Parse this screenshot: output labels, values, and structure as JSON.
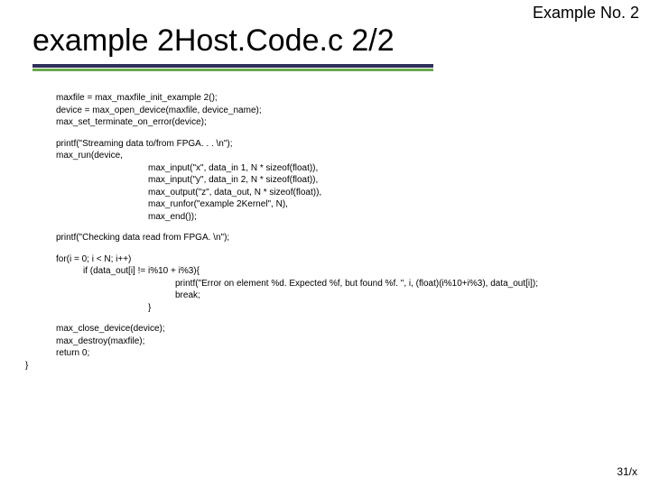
{
  "example_label": "Example No. 2",
  "title": "example 2Host.Code.c 2/2",
  "code": {
    "blk1_l1": "maxfile = max_maxfile_init_example 2();",
    "blk1_l2": "device = max_open_device(maxfile, device_name);",
    "blk1_l3": "max_set_terminate_on_error(device);",
    "blk2_l1": "printf(\"Streaming data to/from FPGA. . . \\n\");",
    "blk2_l2": "max_run(device,",
    "blk2_l3": "max_input(\"x\", data_in 1, N * sizeof(float)),",
    "blk2_l4": "max_input(\"y\", data_in 2, N * sizeof(float)),",
    "blk2_l5": "max_output(\"z\", data_out, N * sizeof(float)),",
    "blk2_l6": "max_runfor(\"example 2Kernel\", N),",
    "blk2_l7": "max_end());",
    "blk3_l1": "printf(\"Checking data read from FPGA. \\n\");",
    "blk4_l1": "for(i = 0; i < N; i++)",
    "blk4_l2": "if (data_out[i] != i%10 + i%3){",
    "blk4_l3": "printf(\"Error on element %d. Expected %f, but found %f. \", i, (float)(i%10+i%3), data_out[i]);",
    "blk4_l4": "break;",
    "blk4_l5": "}",
    "blk5_l1": "max_close_device(device);",
    "blk5_l2": "max_destroy(maxfile);",
    "blk5_l3": "return 0;",
    "blk5_l4": "}"
  },
  "page_num": "31/x"
}
